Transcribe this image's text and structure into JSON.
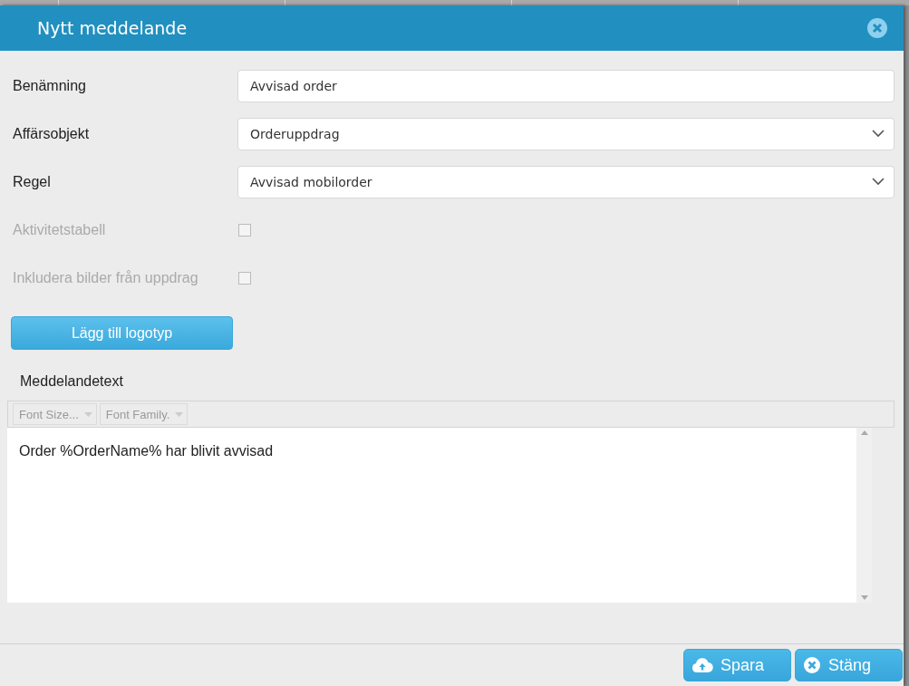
{
  "dialog": {
    "title": "Nytt meddelande"
  },
  "fields": [
    {
      "kind": "text",
      "label": "Benämning",
      "value": "Avvisad order"
    },
    {
      "kind": "select",
      "label": "Affärsobjekt",
      "value": "Orderuppdrag"
    },
    {
      "kind": "select",
      "label": "Regel",
      "value": "Avvisad mobilorder"
    },
    {
      "kind": "checkbox",
      "label": "Aktivitetstabell",
      "checked": false,
      "disabled": true
    },
    {
      "kind": "checkbox",
      "label": "Inkludera bilder från uppdrag",
      "checked": false,
      "disabled": true
    }
  ],
  "logo_button": "Lägg till logotyp",
  "editor": {
    "label": "Meddelandetext",
    "toolbar": [
      "Font Size...",
      "Font Family."
    ],
    "text": "Order %OrderName% har blivit avvisad"
  },
  "buttons": [
    {
      "kind": "save",
      "label": "Spara"
    },
    {
      "kind": "close",
      "label": "Stäng"
    }
  ]
}
